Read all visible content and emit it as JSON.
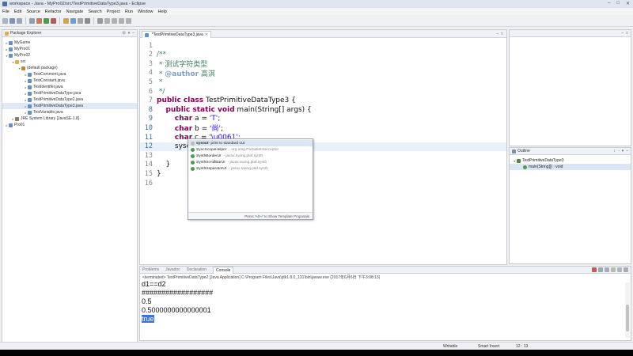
{
  "window": {
    "title": "workspace - Java - MyPro02/src/TestPrimitiveDataType3.java - Eclipse",
    "controls": [
      "–",
      "□",
      "✕"
    ]
  },
  "menu": [
    "File",
    "Edit",
    "Source",
    "Refactor",
    "Navigate",
    "Search",
    "Project",
    "Run",
    "Window",
    "Help"
  ],
  "package_explorer": {
    "title": "Package Explorer",
    "items": [
      {
        "label": "MyGame",
        "level": 0,
        "icon": "project-icon",
        "twisty": "▸"
      },
      {
        "label": "MyPro01",
        "level": 0,
        "icon": "project-icon",
        "twisty": "▸"
      },
      {
        "label": "MyPro02",
        "level": 0,
        "icon": "project-icon",
        "twisty": "▾"
      },
      {
        "label": "src",
        "level": 1,
        "icon": "folder-icon",
        "twisty": "▾"
      },
      {
        "label": "(default package)",
        "level": 2,
        "icon": "package-icon",
        "twisty": "▾"
      },
      {
        "label": "TestComment.java",
        "level": 3,
        "icon": "java-file-icon",
        "twisty": "▸"
      },
      {
        "label": "TestConstant.java",
        "level": 3,
        "icon": "java-file-icon",
        "twisty": "▸"
      },
      {
        "label": "TestIdentifer.java",
        "level": 3,
        "icon": "java-file-icon",
        "twisty": "▸"
      },
      {
        "label": "TestPrimitiveDataType.java",
        "level": 3,
        "icon": "java-file-icon",
        "twisty": "▸"
      },
      {
        "label": "TestPrimitiveDataType2.java",
        "level": 3,
        "icon": "java-file-icon",
        "twisty": "▸"
      },
      {
        "label": "TestPrimitiveDataType3.java",
        "level": 3,
        "icon": "java-file-icon",
        "twisty": "▸",
        "selected": true
      },
      {
        "label": "TestVariable.java",
        "level": 3,
        "icon": "java-file-icon",
        "twisty": "▸"
      },
      {
        "label": "JRE System Library [JavaSE-1.8]",
        "level": 1,
        "icon": "library-icon",
        "twisty": "▸"
      },
      {
        "label": "Pro01",
        "level": 0,
        "icon": "project-icon",
        "twisty": "▸"
      }
    ]
  },
  "editor": {
    "tab_label": "*TestPrimitiveDataType3.java",
    "lines": [
      {
        "n": "1",
        "text": ""
      },
      {
        "n": "2",
        "text": "/**",
        "kind": "comment"
      },
      {
        "n": "3",
        "text": " * 测试字符类型",
        "kind": "comment"
      },
      {
        "n": "4",
        "tag": "@author",
        "text": " * ",
        "rest": " 高淇",
        "kind": "comment-tag"
      },
      {
        "n": "5",
        "text": " *",
        "kind": "comment"
      },
      {
        "n": "6",
        "text": " */",
        "kind": "comment"
      },
      {
        "n": "7",
        "kw": "public class",
        "text": "",
        "rest": " TestPrimitiveDataType3 {",
        "kind": "kw-line"
      },
      {
        "n": "8",
        "kw": "public static void",
        "text": "    ",
        "rest": " main(String[] args) {",
        "kind": "kw-line"
      },
      {
        "n": "9",
        "kw": "char",
        "text": "        ",
        "rest": " a = ",
        "lit": "'T'",
        "tail": ";",
        "kind": "decl"
      },
      {
        "n": "10",
        "kw": "char",
        "text": "        ",
        "rest": " b = ",
        "lit": "'尚'",
        "tail": ";",
        "kind": "decl"
      },
      {
        "n": "11",
        "kw": "char",
        "text": "        ",
        "rest": " c = ",
        "lit": "'\\u0061'",
        "tail": ";",
        "kind": "decl"
      },
      {
        "n": "12",
        "text": "        syso",
        "kind": "plain",
        "active": true
      },
      {
        "n": "13",
        "text": "",
        "kind": "plain"
      },
      {
        "n": "14",
        "text": "    }",
        "kind": "plain"
      },
      {
        "n": "15",
        "text": "}",
        "kind": "plain"
      },
      {
        "n": "16",
        "text": "",
        "kind": "plain"
      }
    ]
  },
  "content_assist": {
    "items": [
      {
        "name": "sysout",
        "desc": " - print to standard out",
        "pkg": ""
      },
      {
        "name": "SyncScopeHelper",
        "desc": "",
        "pkg": "- org.omg.PortableInterceptor"
      },
      {
        "name": "SynthBorderUI",
        "desc": "",
        "pkg": "- javax.swing.plaf.synth"
      },
      {
        "name": "SynthScrollBarUI",
        "desc": "",
        "pkg": "- javax.swing.plaf.synth"
      },
      {
        "name": "SynthSeparatorUI",
        "desc": "",
        "pkg": "- javax.swing.plaf.synth"
      }
    ],
    "footer": "Press 'Alt+/' to Show Template Proposals"
  },
  "outline": {
    "title": "Outline",
    "items": [
      {
        "label": "TestPrimitiveDataType3",
        "level": 0
      },
      {
        "label": "main(String[]) : void",
        "level": 1,
        "selected": true
      }
    ]
  },
  "console": {
    "tabs": [
      "Problems",
      "Javadoc",
      "Declaration",
      "Console"
    ],
    "active_tab": "Console",
    "terminated": "<terminated> TestPrimitiveDataType2 [Java Application] C:\\Program Files\\Java\\jdk1.8.0_131\\bin\\javaw.exe (2017年6月6日 下午3:08:13)",
    "output": [
      "d1==d2",
      "##################",
      "0.5",
      "0.5000000000000001"
    ],
    "selected_output": "true"
  },
  "status": {
    "mode": "Writable",
    "insert": "Smart Insert",
    "position": "12 : 13"
  },
  "colors": {
    "keyword": "#7f0055",
    "comment": "#3f7f5f",
    "string": "#2a00ff",
    "selection": "#3875d7"
  }
}
